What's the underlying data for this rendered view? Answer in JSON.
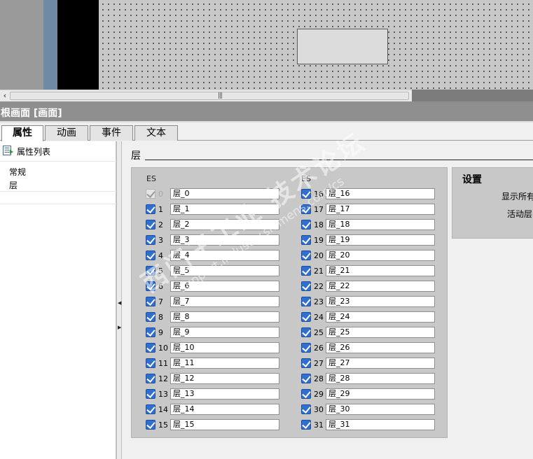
{
  "scroll": {
    "grip": "|||"
  },
  "panel": {
    "title": "根画面 [画面]"
  },
  "tabs": [
    {
      "label": "属性",
      "active": true
    },
    {
      "label": "动画",
      "active": false
    },
    {
      "label": "事件",
      "active": false
    },
    {
      "label": "文本",
      "active": false
    }
  ],
  "nav": {
    "header": "属性列表",
    "items": [
      "常规",
      "层"
    ]
  },
  "section": {
    "title": "层"
  },
  "layers": {
    "col_head_left": "ES",
    "col_head_right": "ES",
    "items": [
      {
        "num": "0",
        "name": "层_0",
        "checked": true,
        "disabled": true
      },
      {
        "num": "1",
        "name": "层_1",
        "checked": true
      },
      {
        "num": "2",
        "name": "层_2",
        "checked": true
      },
      {
        "num": "3",
        "name": "层_3",
        "checked": true
      },
      {
        "num": "4",
        "name": "层_4",
        "checked": true
      },
      {
        "num": "5",
        "name": "层_5",
        "checked": true
      },
      {
        "num": "6",
        "name": "层_6",
        "checked": true
      },
      {
        "num": "7",
        "name": "层_7",
        "checked": true
      },
      {
        "num": "8",
        "name": "层_8",
        "checked": true
      },
      {
        "num": "9",
        "name": "层_9",
        "checked": true
      },
      {
        "num": "10",
        "name": "层_10",
        "checked": true
      },
      {
        "num": "11",
        "name": "层_11",
        "checked": true
      },
      {
        "num": "12",
        "name": "层_12",
        "checked": true
      },
      {
        "num": "13",
        "name": "层_13",
        "checked": true
      },
      {
        "num": "14",
        "name": "层_14",
        "checked": true
      },
      {
        "num": "15",
        "name": "层_15",
        "checked": true
      },
      {
        "num": "16",
        "name": "层_16",
        "checked": true
      },
      {
        "num": "17",
        "name": "层_17",
        "checked": true
      },
      {
        "num": "18",
        "name": "层_18",
        "checked": true
      },
      {
        "num": "19",
        "name": "层_19",
        "checked": true
      },
      {
        "num": "20",
        "name": "层_20",
        "checked": true
      },
      {
        "num": "21",
        "name": "层_21",
        "checked": true
      },
      {
        "num": "22",
        "name": "层_22",
        "checked": true
      },
      {
        "num": "23",
        "name": "层_23",
        "checked": true
      },
      {
        "num": "24",
        "name": "层_24",
        "checked": true
      },
      {
        "num": "25",
        "name": "层_25",
        "checked": true
      },
      {
        "num": "26",
        "name": "层_26",
        "checked": true
      },
      {
        "num": "27",
        "name": "层_27",
        "checked": true
      },
      {
        "num": "28",
        "name": "层_28",
        "checked": true
      },
      {
        "num": "29",
        "name": "层_29",
        "checked": true
      },
      {
        "num": "30",
        "name": "层_30",
        "checked": true
      },
      {
        "num": "31",
        "name": "层_31",
        "checked": true
      }
    ]
  },
  "settings": {
    "title": "设置",
    "show_all_label": "显示所有",
    "active_layer_label": "活动层"
  },
  "watermark": {
    "main": "西门子工业 技术论坛",
    "sub": "support.industry.siemens.com/cs"
  }
}
